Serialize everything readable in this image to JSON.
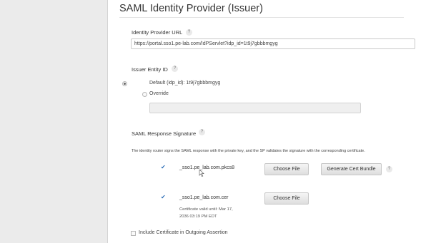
{
  "section": {
    "title": "SAML Identity Provider (Issuer)"
  },
  "idp_url": {
    "label": "Identity Provider URL",
    "help": "?",
    "value": "https://portal.sso1.pe-lab.com/IdPServlet?idp_id=1t9j7gbbbmgyg"
  },
  "issuer_entity": {
    "label": "Issuer Entity ID",
    "help": "?",
    "option_default": "Default (idp_id): 1t9j7gbbbmgyg",
    "option_override": "Override",
    "override_value": ""
  },
  "saml_signature": {
    "label": "SAML Response Signature",
    "help": "?",
    "description": "The identity router signs the SAML response with the private key, and the SP validates the signature with the corresponding certificate.",
    "pkcs8": {
      "check": "✔",
      "filename": "_sso1.pe_lab.com.pkcs8",
      "choose_file": "Choose File",
      "generate": "Generate Cert Bundle",
      "help": "?"
    },
    "cer": {
      "check": "✔",
      "filename": "_sso1.pe_lab.com.cer",
      "choose_file": "Choose File",
      "valid_line1": "Certificate valid until: Mar 17,",
      "valid_line2": "2036 03:19 PM EDT"
    }
  },
  "include_cert": {
    "label": "Include Certificate in Outgoing Assertion"
  }
}
